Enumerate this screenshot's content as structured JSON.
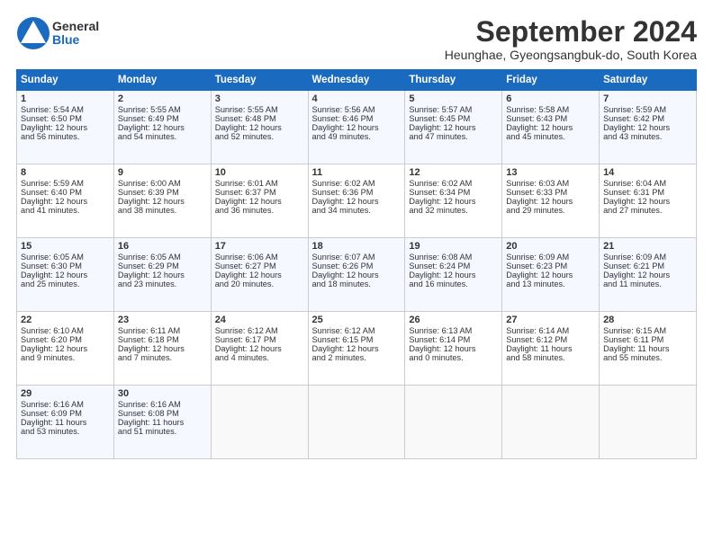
{
  "header": {
    "logo_general": "General",
    "logo_blue": "Blue",
    "month_title": "September 2024",
    "location": "Heunghae, Gyeongsangbuk-do, South Korea"
  },
  "days_of_week": [
    "Sunday",
    "Monday",
    "Tuesday",
    "Wednesday",
    "Thursday",
    "Friday",
    "Saturday"
  ],
  "weeks": [
    [
      {
        "day": "1",
        "lines": [
          "Sunrise: 5:54 AM",
          "Sunset: 6:50 PM",
          "Daylight: 12 hours",
          "and 56 minutes."
        ]
      },
      {
        "day": "2",
        "lines": [
          "Sunrise: 5:55 AM",
          "Sunset: 6:49 PM",
          "Daylight: 12 hours",
          "and 54 minutes."
        ]
      },
      {
        "day": "3",
        "lines": [
          "Sunrise: 5:55 AM",
          "Sunset: 6:48 PM",
          "Daylight: 12 hours",
          "and 52 minutes."
        ]
      },
      {
        "day": "4",
        "lines": [
          "Sunrise: 5:56 AM",
          "Sunset: 6:46 PM",
          "Daylight: 12 hours",
          "and 49 minutes."
        ]
      },
      {
        "day": "5",
        "lines": [
          "Sunrise: 5:57 AM",
          "Sunset: 6:45 PM",
          "Daylight: 12 hours",
          "and 47 minutes."
        ]
      },
      {
        "day": "6",
        "lines": [
          "Sunrise: 5:58 AM",
          "Sunset: 6:43 PM",
          "Daylight: 12 hours",
          "and 45 minutes."
        ]
      },
      {
        "day": "7",
        "lines": [
          "Sunrise: 5:59 AM",
          "Sunset: 6:42 PM",
          "Daylight: 12 hours",
          "and 43 minutes."
        ]
      }
    ],
    [
      {
        "day": "8",
        "lines": [
          "Sunrise: 5:59 AM",
          "Sunset: 6:40 PM",
          "Daylight: 12 hours",
          "and 41 minutes."
        ]
      },
      {
        "day": "9",
        "lines": [
          "Sunrise: 6:00 AM",
          "Sunset: 6:39 PM",
          "Daylight: 12 hours",
          "and 38 minutes."
        ]
      },
      {
        "day": "10",
        "lines": [
          "Sunrise: 6:01 AM",
          "Sunset: 6:37 PM",
          "Daylight: 12 hours",
          "and 36 minutes."
        ]
      },
      {
        "day": "11",
        "lines": [
          "Sunrise: 6:02 AM",
          "Sunset: 6:36 PM",
          "Daylight: 12 hours",
          "and 34 minutes."
        ]
      },
      {
        "day": "12",
        "lines": [
          "Sunrise: 6:02 AM",
          "Sunset: 6:34 PM",
          "Daylight: 12 hours",
          "and 32 minutes."
        ]
      },
      {
        "day": "13",
        "lines": [
          "Sunrise: 6:03 AM",
          "Sunset: 6:33 PM",
          "Daylight: 12 hours",
          "and 29 minutes."
        ]
      },
      {
        "day": "14",
        "lines": [
          "Sunrise: 6:04 AM",
          "Sunset: 6:31 PM",
          "Daylight: 12 hours",
          "and 27 minutes."
        ]
      }
    ],
    [
      {
        "day": "15",
        "lines": [
          "Sunrise: 6:05 AM",
          "Sunset: 6:30 PM",
          "Daylight: 12 hours",
          "and 25 minutes."
        ]
      },
      {
        "day": "16",
        "lines": [
          "Sunrise: 6:05 AM",
          "Sunset: 6:29 PM",
          "Daylight: 12 hours",
          "and 23 minutes."
        ]
      },
      {
        "day": "17",
        "lines": [
          "Sunrise: 6:06 AM",
          "Sunset: 6:27 PM",
          "Daylight: 12 hours",
          "and 20 minutes."
        ]
      },
      {
        "day": "18",
        "lines": [
          "Sunrise: 6:07 AM",
          "Sunset: 6:26 PM",
          "Daylight: 12 hours",
          "and 18 minutes."
        ]
      },
      {
        "day": "19",
        "lines": [
          "Sunrise: 6:08 AM",
          "Sunset: 6:24 PM",
          "Daylight: 12 hours",
          "and 16 minutes."
        ]
      },
      {
        "day": "20",
        "lines": [
          "Sunrise: 6:09 AM",
          "Sunset: 6:23 PM",
          "Daylight: 12 hours",
          "and 13 minutes."
        ]
      },
      {
        "day": "21",
        "lines": [
          "Sunrise: 6:09 AM",
          "Sunset: 6:21 PM",
          "Daylight: 12 hours",
          "and 11 minutes."
        ]
      }
    ],
    [
      {
        "day": "22",
        "lines": [
          "Sunrise: 6:10 AM",
          "Sunset: 6:20 PM",
          "Daylight: 12 hours",
          "and 9 minutes."
        ]
      },
      {
        "day": "23",
        "lines": [
          "Sunrise: 6:11 AM",
          "Sunset: 6:18 PM",
          "Daylight: 12 hours",
          "and 7 minutes."
        ]
      },
      {
        "day": "24",
        "lines": [
          "Sunrise: 6:12 AM",
          "Sunset: 6:17 PM",
          "Daylight: 12 hours",
          "and 4 minutes."
        ]
      },
      {
        "day": "25",
        "lines": [
          "Sunrise: 6:12 AM",
          "Sunset: 6:15 PM",
          "Daylight: 12 hours",
          "and 2 minutes."
        ]
      },
      {
        "day": "26",
        "lines": [
          "Sunrise: 6:13 AM",
          "Sunset: 6:14 PM",
          "Daylight: 12 hours",
          "and 0 minutes."
        ]
      },
      {
        "day": "27",
        "lines": [
          "Sunrise: 6:14 AM",
          "Sunset: 6:12 PM",
          "Daylight: 11 hours",
          "and 58 minutes."
        ]
      },
      {
        "day": "28",
        "lines": [
          "Sunrise: 6:15 AM",
          "Sunset: 6:11 PM",
          "Daylight: 11 hours",
          "and 55 minutes."
        ]
      }
    ],
    [
      {
        "day": "29",
        "lines": [
          "Sunrise: 6:16 AM",
          "Sunset: 6:09 PM",
          "Daylight: 11 hours",
          "and 53 minutes."
        ]
      },
      {
        "day": "30",
        "lines": [
          "Sunrise: 6:16 AM",
          "Sunset: 6:08 PM",
          "Daylight: 11 hours",
          "and 51 minutes."
        ]
      },
      {
        "day": "",
        "lines": []
      },
      {
        "day": "",
        "lines": []
      },
      {
        "day": "",
        "lines": []
      },
      {
        "day": "",
        "lines": []
      },
      {
        "day": "",
        "lines": []
      }
    ]
  ]
}
